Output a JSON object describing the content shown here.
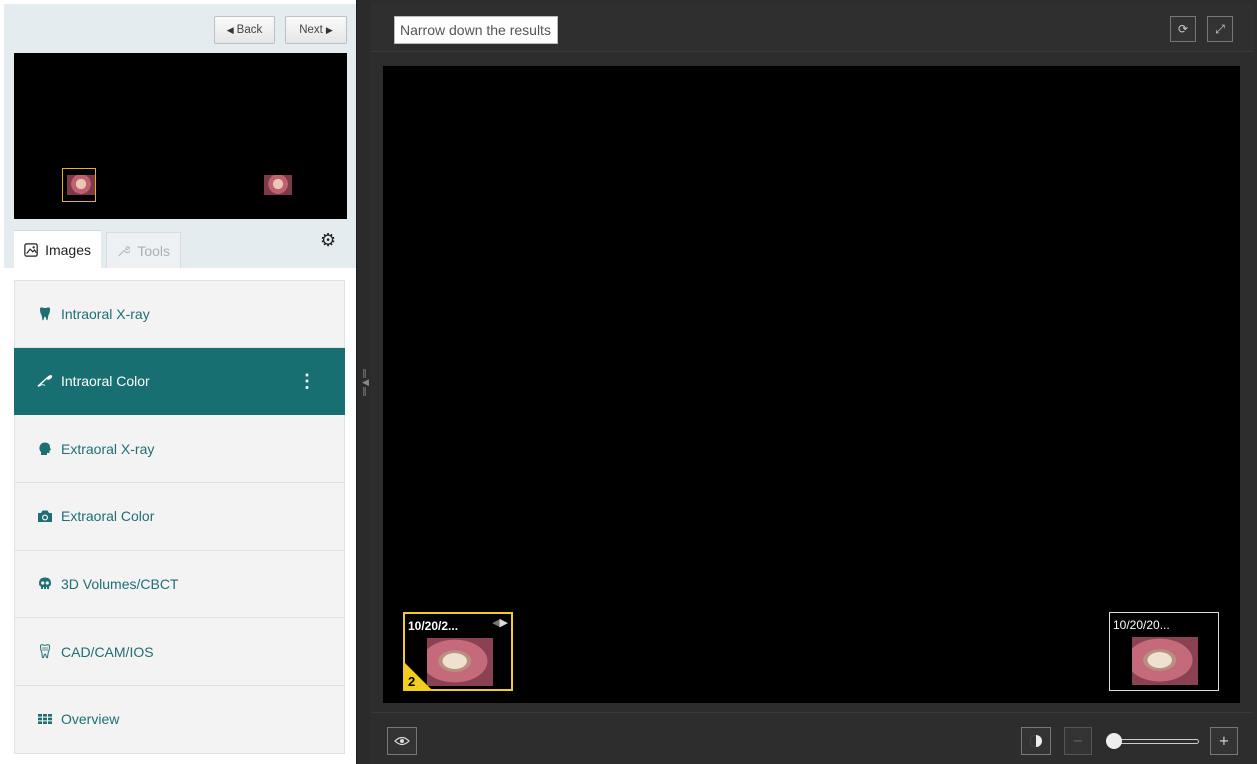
{
  "nav": {
    "back_label": "Back",
    "next_label": "Next"
  },
  "tabs": [
    {
      "label": "Images",
      "icon": "image-icon",
      "active": true
    },
    {
      "label": "Tools",
      "icon": "wrench-icon",
      "active": false
    }
  ],
  "categories": [
    {
      "label": "Intraoral X-ray",
      "icon": "tooth-icon"
    },
    {
      "label": "Intraoral Color",
      "icon": "dental-mirror-icon",
      "active": true
    },
    {
      "label": "Extraoral X-ray",
      "icon": "head-profile-icon"
    },
    {
      "label": "Extraoral Color",
      "icon": "camera-icon"
    },
    {
      "label": "3D Volumes/CBCT",
      "icon": "skull-icon"
    },
    {
      "label": "CAD/CAM/IOS",
      "icon": "tooth-outline-icon"
    },
    {
      "label": "Overview",
      "icon": "grid-icon"
    }
  ],
  "search": {
    "placeholder": "Narrow down the results"
  },
  "thumbnails": [
    {
      "date": "10/20/2...",
      "count": "2",
      "selected": true
    },
    {
      "date": "10/20/20...",
      "selected": false
    }
  ],
  "zoom": {
    "level": 0
  },
  "colors": {
    "accent": "#176f72",
    "selection": "#f3cc22"
  }
}
